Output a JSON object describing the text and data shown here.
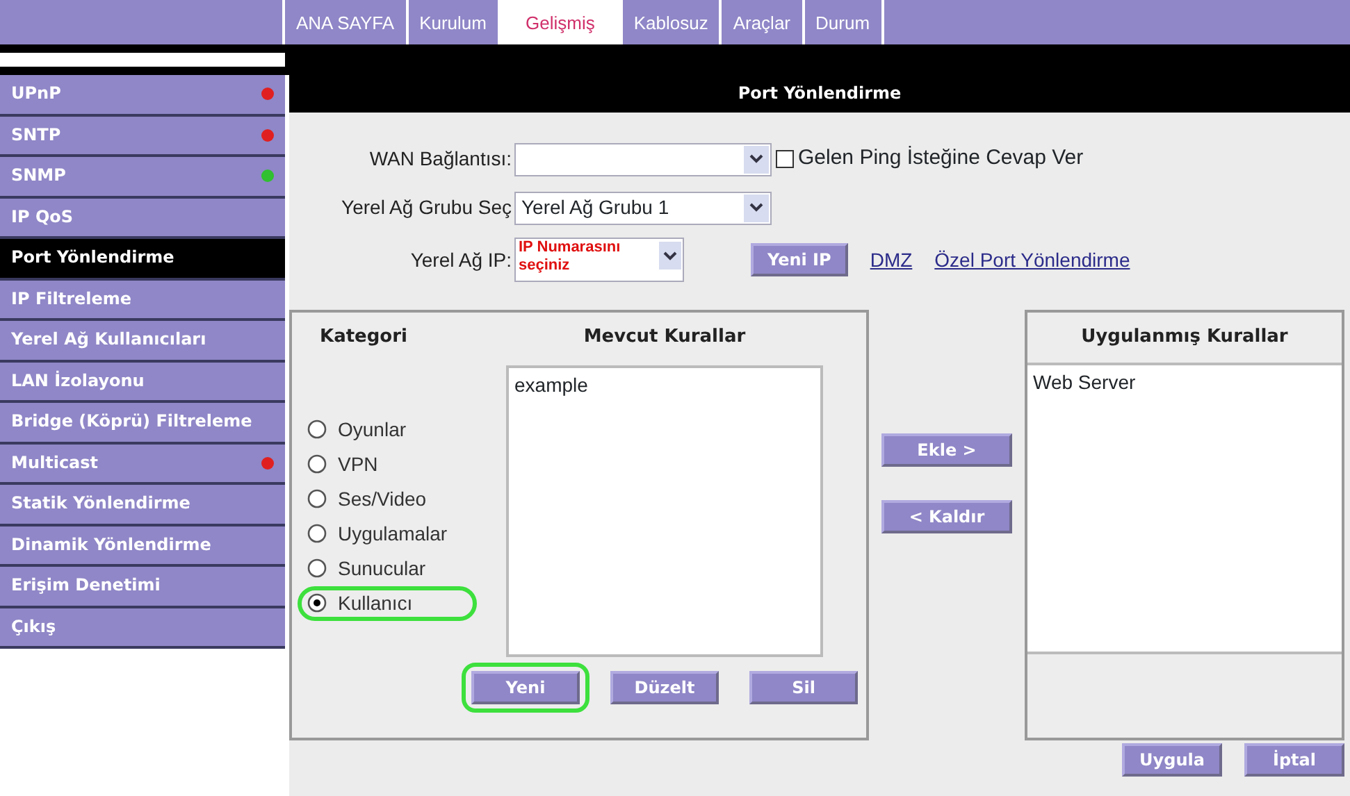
{
  "tabs": [
    {
      "label": "ANA SAYFA",
      "selected": false
    },
    {
      "label": "Kurulum",
      "selected": false
    },
    {
      "label": "Gelişmiş",
      "selected": true
    },
    {
      "label": "Kablosuz",
      "selected": false
    },
    {
      "label": "Araçlar",
      "selected": false
    },
    {
      "label": "Durum",
      "selected": false
    }
  ],
  "sidebar": {
    "items": [
      {
        "label": "UPnP",
        "selected": false,
        "color": "#e02020"
      },
      {
        "label": "SNTP",
        "selected": false,
        "color": "#e02020"
      },
      {
        "label": "SNMP",
        "selected": false,
        "color": "#30c030"
      },
      {
        "label": "IP QoS",
        "selected": false
      },
      {
        "label": "Port Yönlendirme",
        "selected": true
      },
      {
        "label": "IP Filtreleme",
        "selected": false
      },
      {
        "label": "Yerel Ağ Kullanıcıları",
        "selected": false
      },
      {
        "label": "LAN İzolayonu",
        "selected": false
      },
      {
        "label": "Bridge (Köprü) Filtreleme",
        "selected": false
      },
      {
        "label": "Multicast",
        "selected": false,
        "color": "#e02020"
      },
      {
        "label": "Statik Yönlendirme",
        "selected": false
      },
      {
        "label": "Dinamik Yönlendirme",
        "selected": false
      },
      {
        "label": "Erişim Denetimi",
        "selected": false
      },
      {
        "label": "Çıkış",
        "selected": false
      }
    ]
  },
  "header": {
    "title": "Port Yönlendirme"
  },
  "form": {
    "wan_label": "WAN Bağlantısı:",
    "ping_checkbox": {
      "label": "Gelen Ping İsteğine Cevap Ver",
      "checked": false
    },
    "group_label": "Yerel Ağ Grubu Seç",
    "group_value": "Yerel Ağ Grubu 1",
    "ip_label": "Yerel Ağ IP:",
    "ip_value": "IP Numarasını seçiniz",
    "new_ip_button": "Yeni IP",
    "links": [
      "DMZ",
      "Özel Port Yönlendirme"
    ]
  },
  "category": {
    "title": "Kategori",
    "options": [
      {
        "label": "Oyunlar",
        "selected": false,
        "highlighted": false
      },
      {
        "label": "VPN",
        "selected": false,
        "highlighted": false
      },
      {
        "label": "Ses/Video",
        "selected": false,
        "highlighted": false
      },
      {
        "label": "Uygulamalar",
        "selected": false,
        "highlighted": false
      },
      {
        "label": "Sunucular",
        "selected": false,
        "highlighted": false
      },
      {
        "label": "Kullanıcı",
        "selected": true,
        "highlighted": true
      }
    ]
  },
  "available_rules": {
    "title": "Mevcut Kurallar",
    "items": [
      "example"
    ],
    "buttons": [
      {
        "label": "Yeni",
        "highlighted": true
      },
      {
        "label": "Düzelt",
        "highlighted": false
      },
      {
        "label": "Sil",
        "highlighted": false
      }
    ]
  },
  "move_buttons": [
    "Ekle >",
    "< Kaldır"
  ],
  "applied_rules": {
    "title": "Uygulanmış Kurallar",
    "items": [
      "Web Server"
    ]
  },
  "footer_buttons": [
    "Uygula",
    "İptal"
  ]
}
